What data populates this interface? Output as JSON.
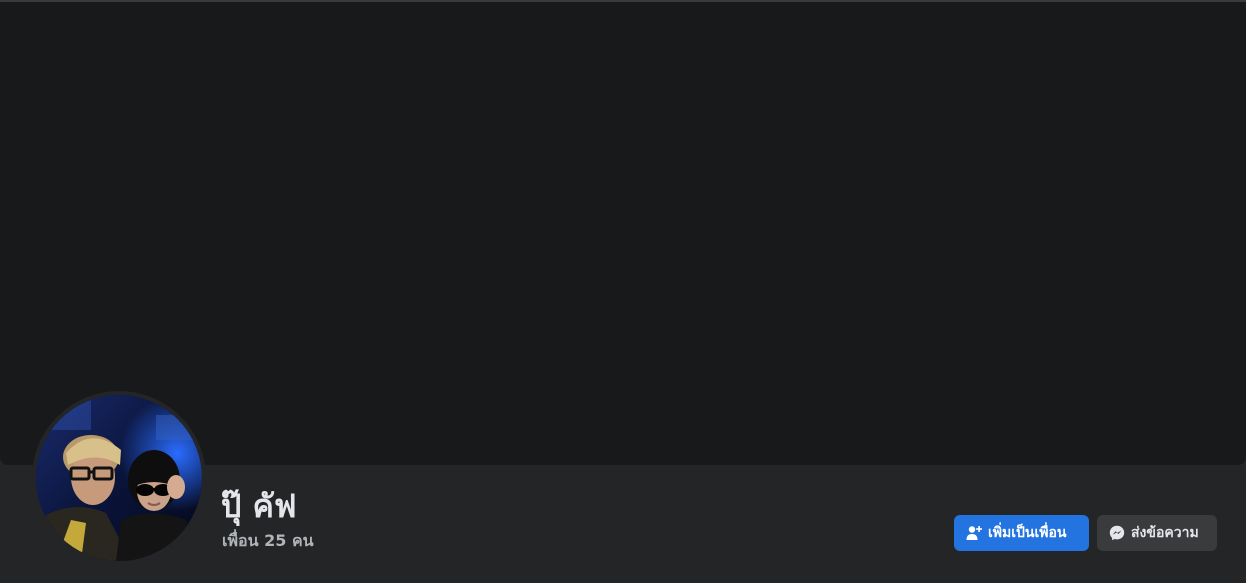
{
  "profile": {
    "name": "ปุ๊ คัฟ",
    "friends_label": "เพื่อน 25 คน",
    "avatar_icon": "profile-photo"
  },
  "actions": {
    "add_friend_label": "เพิ่มเป็นเพื่อน",
    "add_friend_icon": "add-friend-icon",
    "message_label": "ส่งข้อความ",
    "message_icon": "messenger-icon"
  },
  "colors": {
    "page_background": "#242526",
    "cover_background": "#18191a",
    "primary_button": "#2374e1",
    "secondary_button": "#3a3b3c",
    "text_primary": "#e4e6eb",
    "text_secondary": "#b0b3b8"
  }
}
